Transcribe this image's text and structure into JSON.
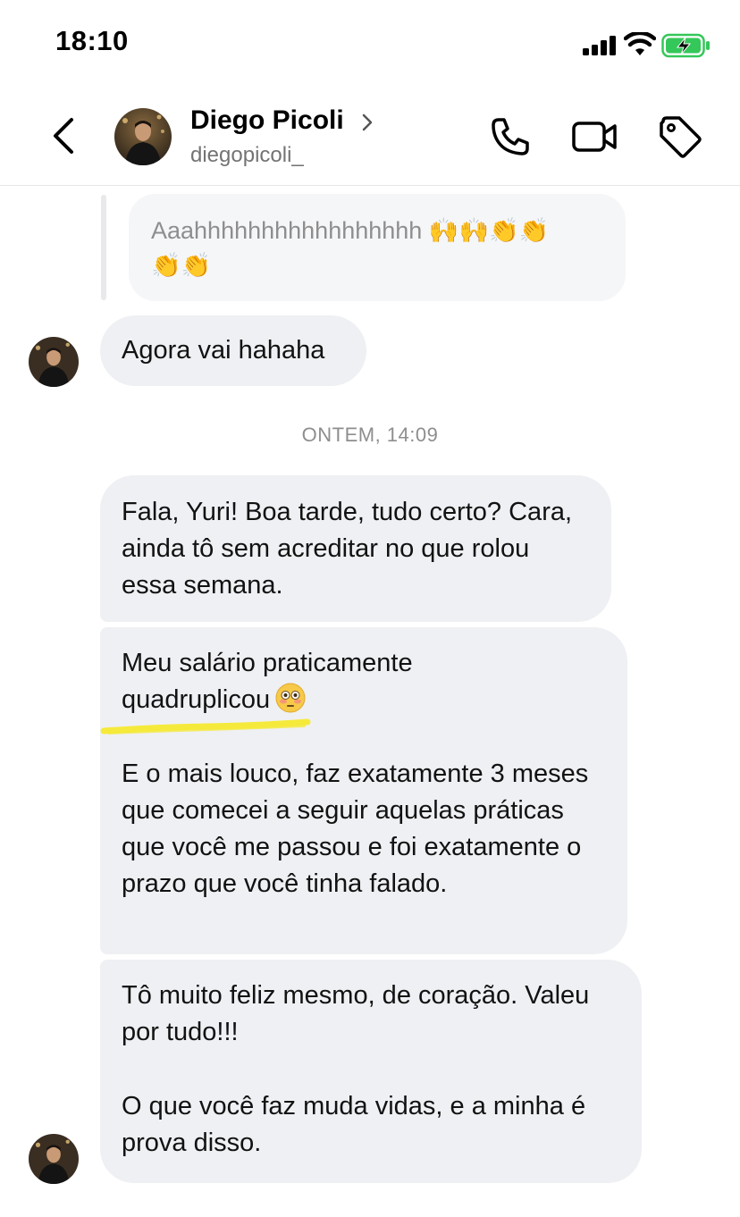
{
  "status_bar": {
    "time": "18:10",
    "signal_icon": "cellular-signal-icon",
    "wifi_icon": "wifi-icon",
    "battery_icon": "battery-charging-icon",
    "battery_color": "#34c759"
  },
  "header": {
    "contact_name": "Diego Picoli",
    "contact_handle": "diegopicoli_",
    "icons": [
      "back-chevron-icon",
      "chevron-right-icon",
      "phone-icon",
      "video-call-icon",
      "tag-icon"
    ]
  },
  "chat": {
    "quoted_message": {
      "text": "Aaahhhhhhhhhhhhhhhhh",
      "emoji_line1": "🙌🙌👏👏",
      "emoji_line2": "👏👏"
    },
    "message_1": "Agora vai hahaha",
    "timestamp": "ONTEM, 14:09",
    "message_2": "Fala, Yuri! Boa tarde, tudo certo? Cara, ainda tô sem acreditar no que rolou essa semana.",
    "message_3": {
      "line_a": "Meu salário praticamente",
      "line_b": "quadruplicou",
      "emoji": "flushed-face",
      "paragraph_2": "E o mais louco, faz exatamente 3 meses que comecei a seguir aquelas práticas que você me passou e foi exatamente o prazo que você tinha falado."
    },
    "message_4": {
      "paragraph_1": "Tô muito feliz mesmo, de coração. Valeu por tudo!!!",
      "paragraph_2": "O que você faz muda vidas, e a minha é prova disso."
    },
    "highlight_color": "#f5ea3b"
  }
}
